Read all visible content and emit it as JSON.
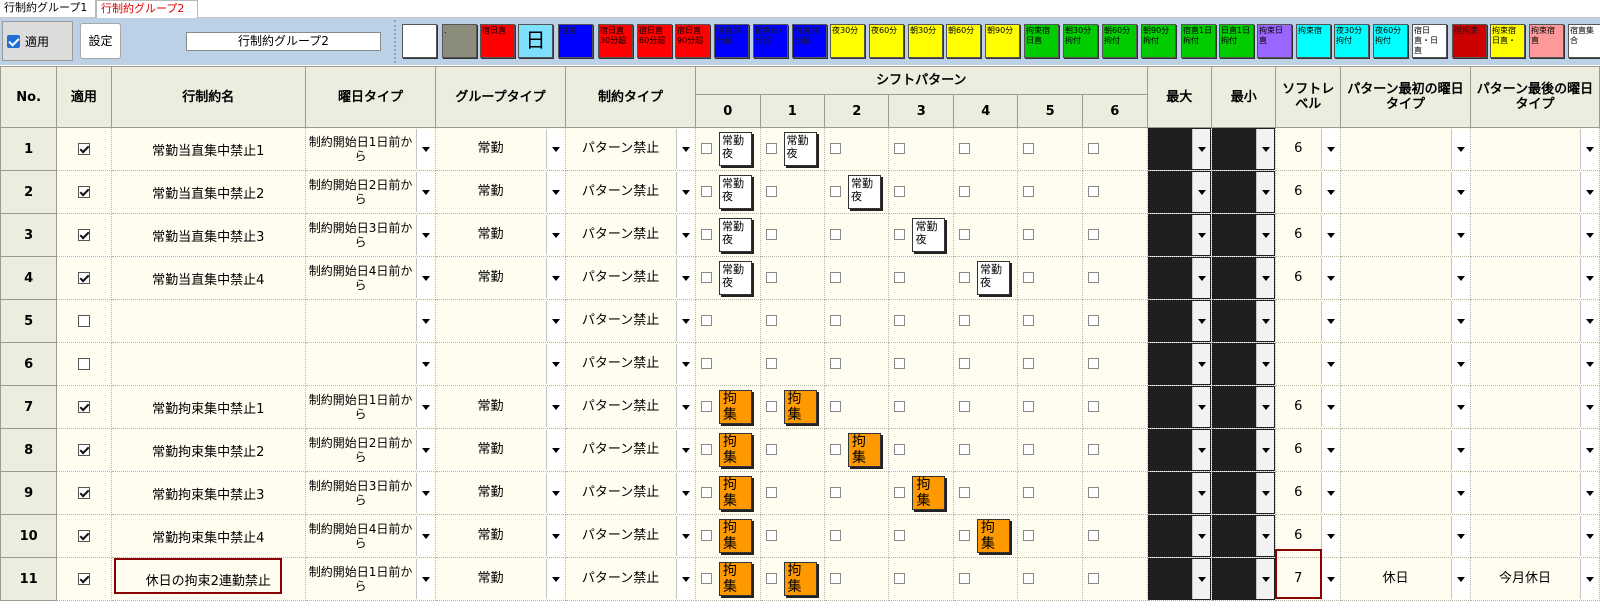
{
  "tabs": [
    {
      "label": "行制約グループ1"
    },
    {
      "label": "行制約グループ2"
    }
  ],
  "toolbar": {
    "apply_label": "適用",
    "setting_label": "設定",
    "group_name": "行制約グループ2",
    "palette": [
      {
        "label": "",
        "color": "#ffffff"
      },
      {
        "label": ".",
        "color": "#8c8c7a"
      },
      {
        "label": "宿日直",
        "color": "#ff0000"
      },
      {
        "label": "日",
        "color": "#7fdfff"
      },
      {
        "label": "宿直",
        "color": "#0000ff"
      },
      {
        "label": "宿日直30分超",
        "color": "#ff0000"
      },
      {
        "label": "宿日直60分超",
        "color": "#ff0000"
      },
      {
        "label": "宿日直90分超",
        "color": "#ff0000"
      },
      {
        "label": "宿直30分超",
        "color": "#0000ff"
      },
      {
        "label": "宿直60分超",
        "color": "#0000ff"
      },
      {
        "label": "宿直90分超",
        "color": "#0000ff"
      },
      {
        "label": "夜30分",
        "color": "#ffff00"
      },
      {
        "label": "夜60分",
        "color": "#ffff00"
      },
      {
        "label": "朝30分",
        "color": "#ffff00"
      },
      {
        "label": "朝60分",
        "color": "#ffff00"
      },
      {
        "label": "朝90分",
        "color": "#ffff00"
      },
      {
        "label": "拘束宿日直",
        "color": "#00cc00"
      },
      {
        "label": "朝30分拘付",
        "color": "#00cc00"
      },
      {
        "label": "朝60分拘付",
        "color": "#00cc00"
      },
      {
        "label": "朝90分拘付",
        "color": "#00cc00"
      },
      {
        "label": "宿直1日拘付",
        "color": "#00cc00"
      },
      {
        "label": "日直1日拘付",
        "color": "#00cc00"
      },
      {
        "label": "拘束日直",
        "color": "#9966ff"
      },
      {
        "label": "拘束宿",
        "color": "#00ffff"
      },
      {
        "label": "夜30分拘付",
        "color": "#00ffff"
      },
      {
        "label": "夜60分拘付",
        "color": "#00ffff"
      },
      {
        "label": "宿日直・日直",
        "color": "#ffffff"
      },
      {
        "label": "宿拘束",
        "color": "#cc0000"
      },
      {
        "label": "拘束宿日直・",
        "color": "#ffff00"
      },
      {
        "label": "拘束宿直",
        "color": "#ff9999"
      },
      {
        "label": "宿直集合",
        "color": "#ffffff"
      }
    ]
  },
  "grid": {
    "headers": {
      "no": "No.",
      "apply": "適用",
      "name": "行制約名",
      "weekday_type": "曜日タイプ",
      "group_type": "グループタイプ",
      "constraint_type": "制約タイプ",
      "shift_pattern": "シフトパターン",
      "shift_cols": [
        "0",
        "1",
        "2",
        "3",
        "4",
        "5",
        "6"
      ],
      "max": "最大",
      "min": "最小",
      "soft_level": "ソフトレベル",
      "first_day_type": "パターン最初の曜日タイプ",
      "last_day_type": "パターン最後の曜日タイプ"
    },
    "rows": [
      {
        "no": "1",
        "checked": true,
        "name": "常勤当直集中禁止1",
        "weekday": "制約開始日1日前から",
        "group": "常勤",
        "ctype": "パターン禁止",
        "chips": {
          "0": "常勤夜",
          "1": "常勤夜"
        },
        "chip_style": "white",
        "soft": "6",
        "first": "",
        "last": ""
      },
      {
        "no": "2",
        "checked": true,
        "name": "常勤当直集中禁止2",
        "weekday": "制約開始日2日前から",
        "group": "常勤",
        "ctype": "パターン禁止",
        "chips": {
          "0": "常勤夜",
          "2": "常勤夜"
        },
        "chip_style": "white",
        "soft": "6",
        "first": "",
        "last": ""
      },
      {
        "no": "3",
        "checked": true,
        "name": "常勤当直集中禁止3",
        "weekday": "制約開始日3日前から",
        "group": "常勤",
        "ctype": "パターン禁止",
        "chips": {
          "0": "常勤夜",
          "3": "常勤夜"
        },
        "chip_style": "white",
        "soft": "6",
        "first": "",
        "last": ""
      },
      {
        "no": "4",
        "checked": true,
        "name": "常勤当直集中禁止4",
        "weekday": "制約開始日4日前から",
        "group": "常勤",
        "ctype": "パターン禁止",
        "chips": {
          "0": "常勤夜",
          "4": "常勤夜"
        },
        "chip_style": "white",
        "soft": "6",
        "first": "",
        "last": ""
      },
      {
        "no": "5",
        "checked": false,
        "name": "",
        "weekday": "",
        "group": "",
        "ctype": "パターン禁止",
        "chips": {},
        "chip_style": "white",
        "soft": "",
        "first": "",
        "last": ""
      },
      {
        "no": "6",
        "checked": false,
        "name": "",
        "weekday": "",
        "group": "",
        "ctype": "パターン禁止",
        "chips": {},
        "chip_style": "white",
        "soft": "",
        "first": "",
        "last": ""
      },
      {
        "no": "7",
        "checked": true,
        "name": "常勤拘束集中禁止1",
        "weekday": "制約開始日1日前から",
        "group": "常勤",
        "ctype": "パターン禁止",
        "chips": {
          "0": "拘集",
          "1": "拘集"
        },
        "chip_style": "orange",
        "soft": "6",
        "first": "",
        "last": ""
      },
      {
        "no": "8",
        "checked": true,
        "name": "常勤拘束集中禁止2",
        "weekday": "制約開始日2日前から",
        "group": "常勤",
        "ctype": "パターン禁止",
        "chips": {
          "0": "拘集",
          "2": "拘集"
        },
        "chip_style": "orange",
        "soft": "6",
        "first": "",
        "last": ""
      },
      {
        "no": "9",
        "checked": true,
        "name": "常勤拘束集中禁止3",
        "weekday": "制約開始日3日前から",
        "group": "常勤",
        "ctype": "パターン禁止",
        "chips": {
          "0": "拘集",
          "3": "拘集"
        },
        "chip_style": "orange",
        "soft": "6",
        "first": "",
        "last": ""
      },
      {
        "no": "10",
        "checked": true,
        "name": "常勤拘束集中禁止4",
        "weekday": "制約開始日4日前から",
        "group": "常勤",
        "ctype": "パターン禁止",
        "chips": {
          "0": "拘集",
          "4": "拘集"
        },
        "chip_style": "orange",
        "soft": "6",
        "first": "",
        "last": ""
      },
      {
        "no": "11",
        "checked": true,
        "name": "休日の拘束2連勤禁止",
        "weekday": "制約開始日1日前から",
        "group": "常勤",
        "ctype": "パターン禁止",
        "chips": {
          "0": "拘集",
          "1": "拘集"
        },
        "chip_style": "orange",
        "soft": "7",
        "first": "休日",
        "last": "今月休日"
      }
    ]
  }
}
